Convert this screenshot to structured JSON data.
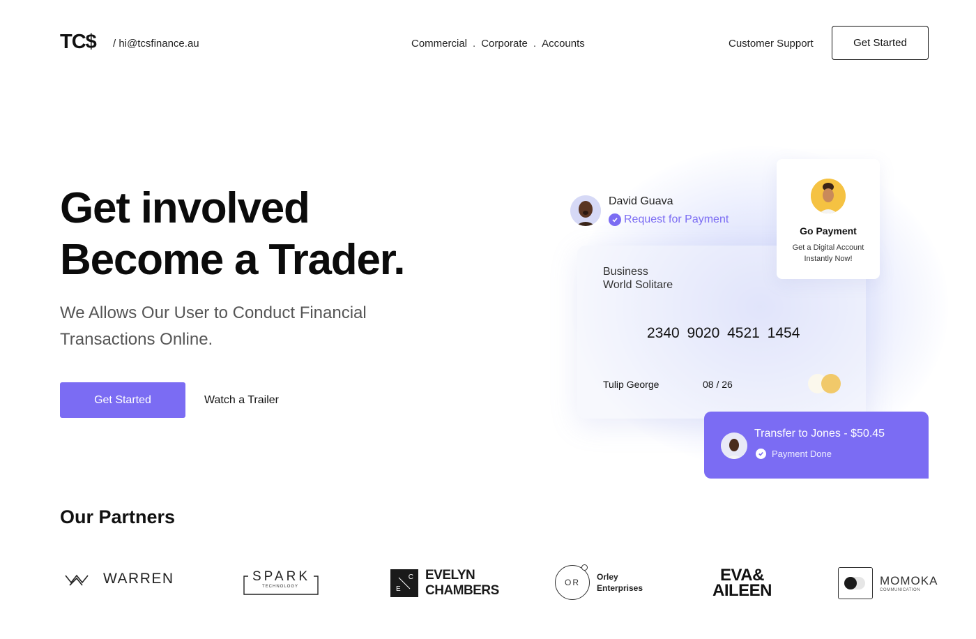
{
  "header": {
    "logo": "TC$",
    "email": "/ hi@tcsfinance.au",
    "nav": [
      {
        "label": "Commercial"
      },
      {
        "label": "Corporate"
      },
      {
        "label": "Accounts"
      }
    ],
    "nav_separator": ".",
    "support_label": "Customer Support",
    "cta_label": "Get Started"
  },
  "hero": {
    "title_line1": "Get involved",
    "title_line2": "Become a Trader.",
    "subtitle": "We Allows Our User to Conduct Financial Transactions Online.",
    "primary_cta": "Get Started",
    "secondary_cta": "Watch a Trailer"
  },
  "payment_request": {
    "name": "David Guava",
    "status": "Request for Payment",
    "icon": "check-circle-icon"
  },
  "go_payment": {
    "title": "Go Payment",
    "subtitle": "Get a Digital Account Instantly Now!"
  },
  "card": {
    "title_line1": "Business",
    "title_line2": "World Solitare",
    "number": "2340 9020 4521 1454",
    "holder": "Tulip George",
    "expiry": "08 / 26"
  },
  "transfer": {
    "title": "Transfer to Jones - $50.45",
    "status": "Payment Done"
  },
  "partners": {
    "title": "Our Partners",
    "items": [
      {
        "name": "WARREN"
      },
      {
        "name": "SPARK",
        "sub": "TECHNOLOGY"
      },
      {
        "name_line1": "EVELYN",
        "name_line2": "CHAMBERS",
        "mark_letters": [
          "C",
          "E"
        ]
      },
      {
        "name_line1": "Orley",
        "name_line2": "Enterprises",
        "mark": "OR"
      },
      {
        "name_line1": "EVA&",
        "name_line2": "AILEEN"
      },
      {
        "name": "MOMOKA",
        "sub": "COMMUNICATION"
      }
    ]
  },
  "colors": {
    "accent": "#7b6cf3",
    "text": "#111111",
    "muted": "#555555",
    "chip": "#f1c96a"
  }
}
